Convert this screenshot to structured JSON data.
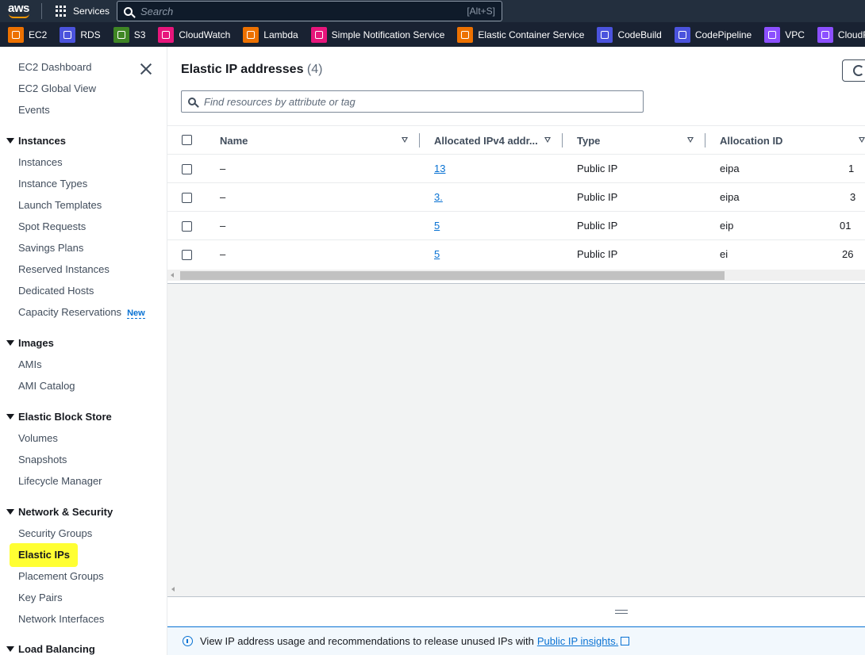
{
  "topnav": {
    "logo": "aws",
    "services_label": "Services",
    "search_placeholder": "Search",
    "search_hint": "[Alt+S]"
  },
  "favorites": [
    {
      "label": "EC2",
      "color": "#ed7100"
    },
    {
      "label": "RDS",
      "color": "#4b53dd"
    },
    {
      "label": "S3",
      "color": "#3f8624"
    },
    {
      "label": "CloudWatch",
      "color": "#e7157b"
    },
    {
      "label": "Lambda",
      "color": "#ed7100"
    },
    {
      "label": "Simple Notification Service",
      "color": "#e7157b"
    },
    {
      "label": "Elastic Container Service",
      "color": "#ed7100"
    },
    {
      "label": "CodeBuild",
      "color": "#4b53dd"
    },
    {
      "label": "CodePipeline",
      "color": "#4b53dd"
    },
    {
      "label": "VPC",
      "color": "#8c4fff"
    },
    {
      "label": "CloudFront",
      "color": "#8c4fff"
    },
    {
      "label": "",
      "color": "#8c4fff"
    }
  ],
  "sidebar": {
    "top_links": [
      "EC2 Dashboard",
      "EC2 Global View",
      "Events"
    ],
    "sections": {
      "instances": {
        "title": "Instances",
        "items": [
          "Instances",
          "Instance Types",
          "Launch Templates",
          "Spot Requests",
          "Savings Plans",
          "Reserved Instances",
          "Dedicated Hosts",
          "Capacity Reservations"
        ],
        "new_badge": "New"
      },
      "images": {
        "title": "Images",
        "items": [
          "AMIs",
          "AMI Catalog"
        ]
      },
      "ebs": {
        "title": "Elastic Block Store",
        "items": [
          "Volumes",
          "Snapshots",
          "Lifecycle Manager"
        ]
      },
      "network": {
        "title": "Network & Security",
        "items": [
          "Security Groups",
          "Elastic IPs",
          "Placement Groups",
          "Key Pairs",
          "Network Interfaces"
        ]
      },
      "lb": {
        "title": "Load Balancing"
      }
    },
    "highlight_color": "#ffff33"
  },
  "main": {
    "title": "Elastic IP addresses",
    "count": "(4)",
    "filter_placeholder": "Find resources by attribute or tag",
    "columns": [
      "Name",
      "Allocated IPv4 addr...",
      "Type",
      "Allocation ID"
    ],
    "rows": [
      {
        "name": "–",
        "ip": "13",
        "type": "Public IP",
        "alloc_prefix": "eipa",
        "alloc_suffix": "1"
      },
      {
        "name": "–",
        "ip": "3.",
        "type": "Public IP",
        "alloc_prefix": "eipa",
        "alloc_suffix": "3"
      },
      {
        "name": "–",
        "ip": "5",
        "type": "Public IP",
        "alloc_prefix": "eip",
        "alloc_suffix": "01"
      },
      {
        "name": "–",
        "ip": "5",
        "type": "Public IP",
        "alloc_prefix": "ei",
        "alloc_suffix": "26"
      }
    ],
    "info_text": "View IP address usage and recommendations to release unused IPs with",
    "info_link": "Public IP insights."
  }
}
